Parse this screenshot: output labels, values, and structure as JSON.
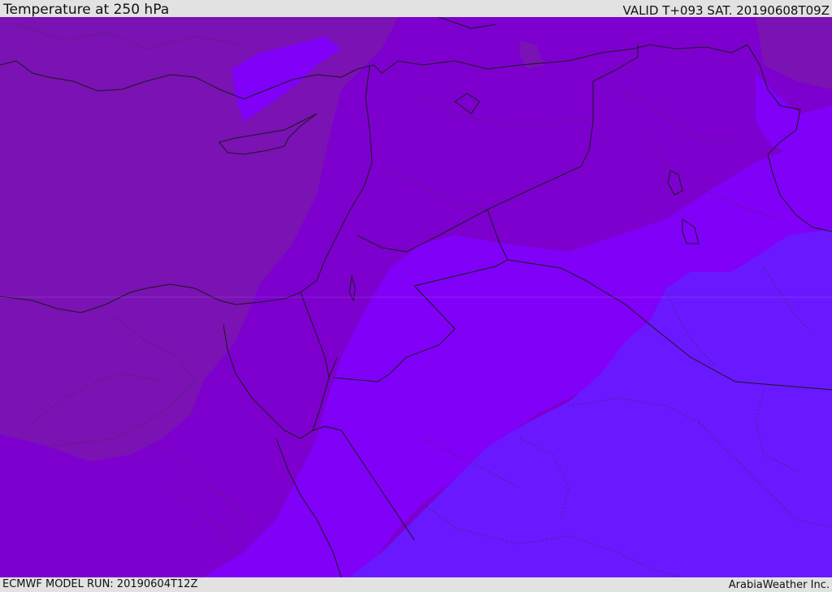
{
  "header": {
    "title": "Temperature at 250 hPa",
    "valid": "VALID T+093 SAT. 20190608T09Z"
  },
  "footer": {
    "model_run": "ECMWF MODEL RUN: 20190604T12Z",
    "credit": "ArabiaWeather Inc."
  },
  "map": {
    "field": "temperature-250hPa",
    "colors": {
      "warmest": "#7a12b4",
      "warm": "#7d00cf",
      "mid": "#8000f8",
      "cool": "#6a18ff",
      "coastline": "#1a1a1a",
      "border": "#1a1a1a"
    }
  }
}
